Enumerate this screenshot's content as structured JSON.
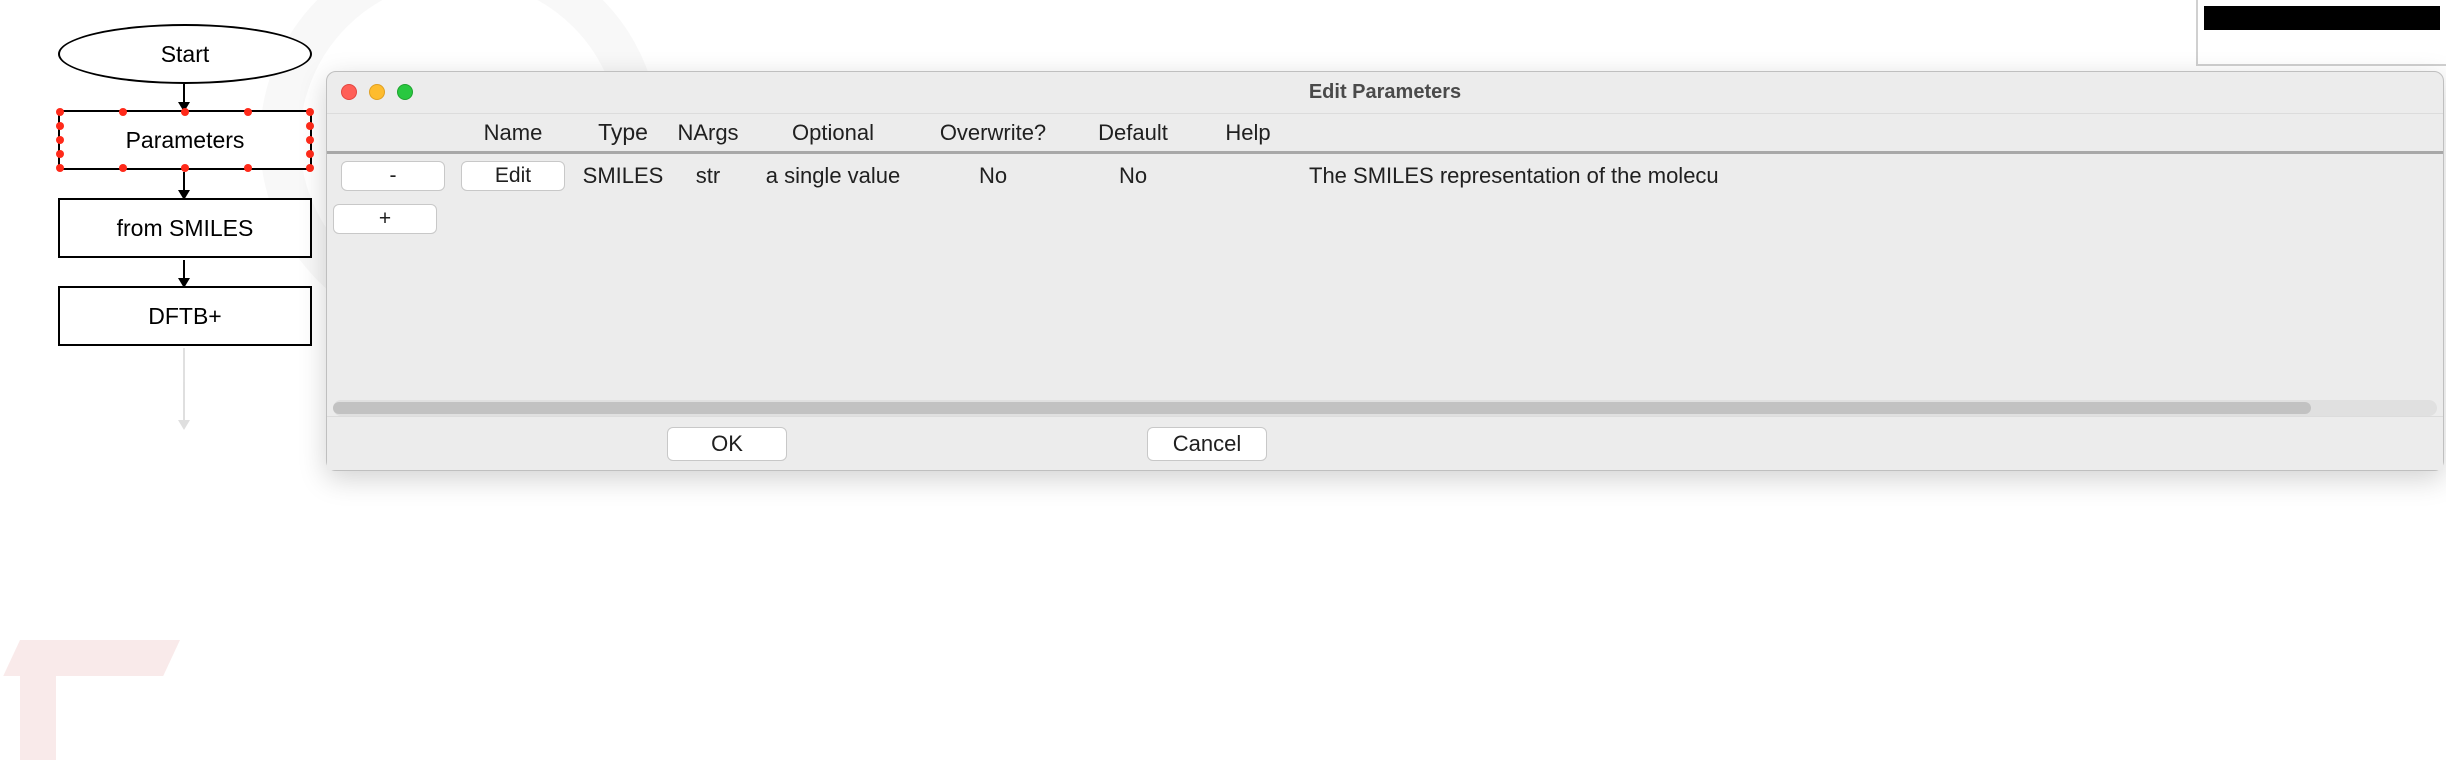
{
  "flowchart": {
    "start": "Start",
    "parameters": "Parameters",
    "from_smiles": "from SMILES",
    "dftb": "DFTB+"
  },
  "dialog": {
    "title": "Edit Parameters",
    "columns": {
      "name": "Name",
      "type": "Type",
      "nargs": "NArgs",
      "optional": "Optional",
      "overwrite": "Overwrite?",
      "default": "Default",
      "help": "Help"
    },
    "rows": [
      {
        "remove": "-",
        "edit": "Edit",
        "name": "SMILES",
        "type": "str",
        "nargs": "a single value",
        "optional": "No",
        "overwrite": "No",
        "default": "",
        "help": "The SMILES representation of the molecu"
      }
    ],
    "add": "+",
    "ok": "OK",
    "cancel": "Cancel"
  }
}
